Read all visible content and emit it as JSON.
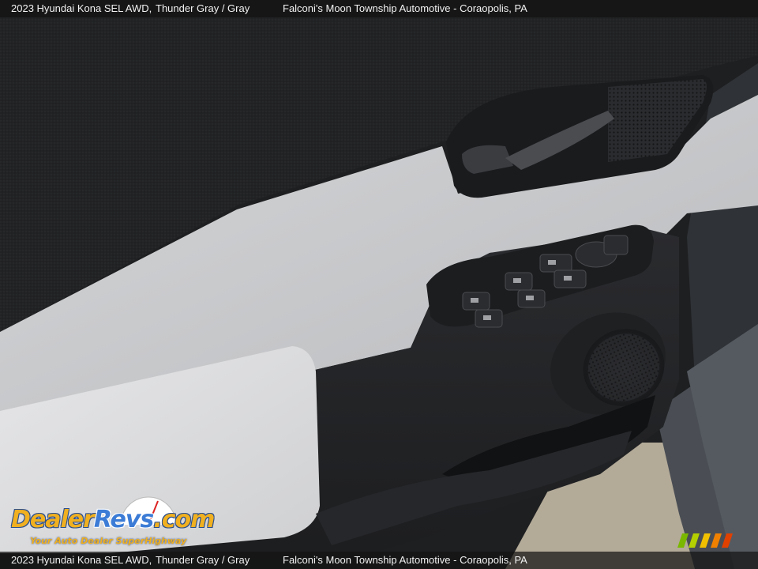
{
  "caption": {
    "vehicle": "2023 Hyundai Kona SEL AWD,",
    "color": "Thunder Gray / Gray",
    "dealer": "Falconi's Moon Township Automotive - Coraopolis, PA"
  },
  "watermark": {
    "logo_prefix": "Dealer",
    "logo_brand": "Revs",
    "logo_suffix": ".com",
    "tagline": "Your Auto Dealer SuperHighway"
  },
  "colors": {
    "door_panel_upper": "#222325",
    "door_trim_light": "#c9cacc",
    "armrest": "#dcdcde",
    "switch_bezel": "#1c1d1f",
    "body_paint": "#4a4e54",
    "floor": "#b3aa98",
    "watermark_orange": "#f0b020",
    "watermark_blue": "#3c7cd6"
  },
  "icons": [
    "window-switch-icon",
    "door-lock-icon",
    "mirror-control-icon",
    "speaker-grille-icon",
    "door-handle-icon"
  ]
}
